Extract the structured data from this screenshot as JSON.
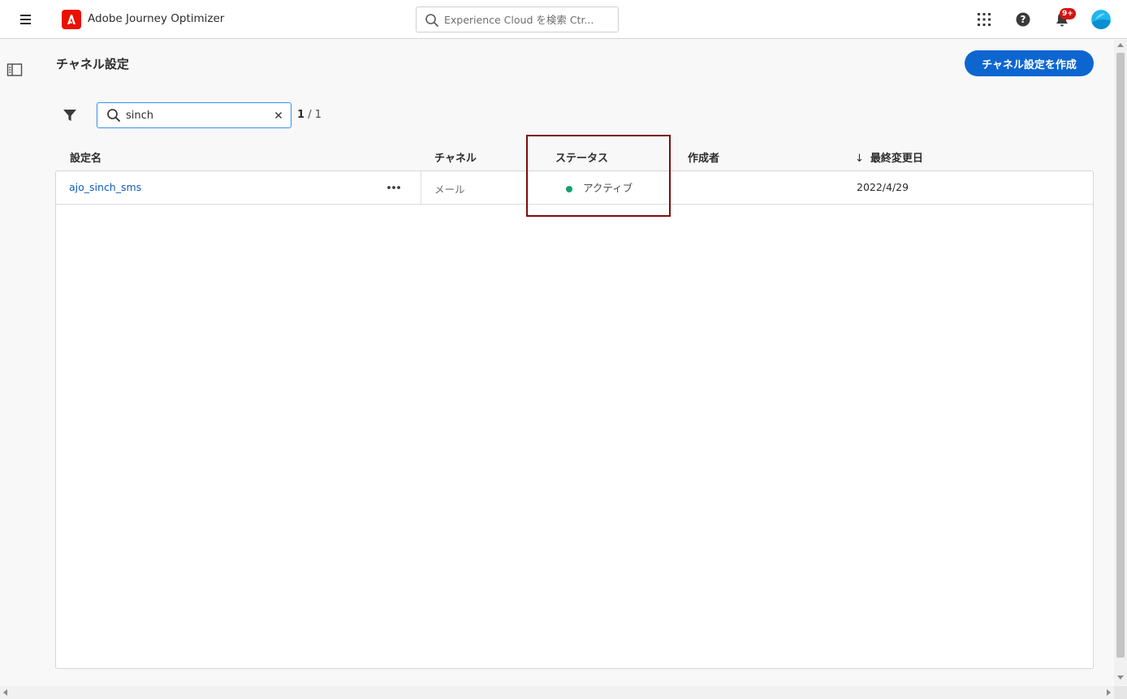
{
  "header": {
    "app_title": "Adobe Journey Optimizer",
    "search_placeholder": "Experience Cloud を検索 Ctr...",
    "notification_count": "9+"
  },
  "page": {
    "title": "チャネル設定",
    "create_button": "チャネル設定を作成"
  },
  "search": {
    "value": "sinch",
    "result_current": "1",
    "result_total": "/ 1"
  },
  "table": {
    "columns": {
      "name": "設定名",
      "channel": "チャネル",
      "status": "ステータス",
      "author": "作成者",
      "modified": "最終変更日"
    },
    "sort_indicator": "↓",
    "rows": [
      {
        "name": "ajo_sinch_sms",
        "channel": "メール",
        "status": "アクティブ",
        "author": "",
        "modified": "2022/4/29"
      }
    ]
  },
  "colors": {
    "accent": "#0d66d0",
    "brand": "#eb1000",
    "status_active": "#12a26c",
    "highlight_box": "#7d0d0d"
  },
  "icons": [
    "menu-icon",
    "adobe-logo-icon",
    "search-icon",
    "apps-grid-icon",
    "help-icon",
    "bell-icon",
    "avatar",
    "panel-toggle-icon",
    "filter-icon",
    "clear-icon",
    "more-icon"
  ]
}
